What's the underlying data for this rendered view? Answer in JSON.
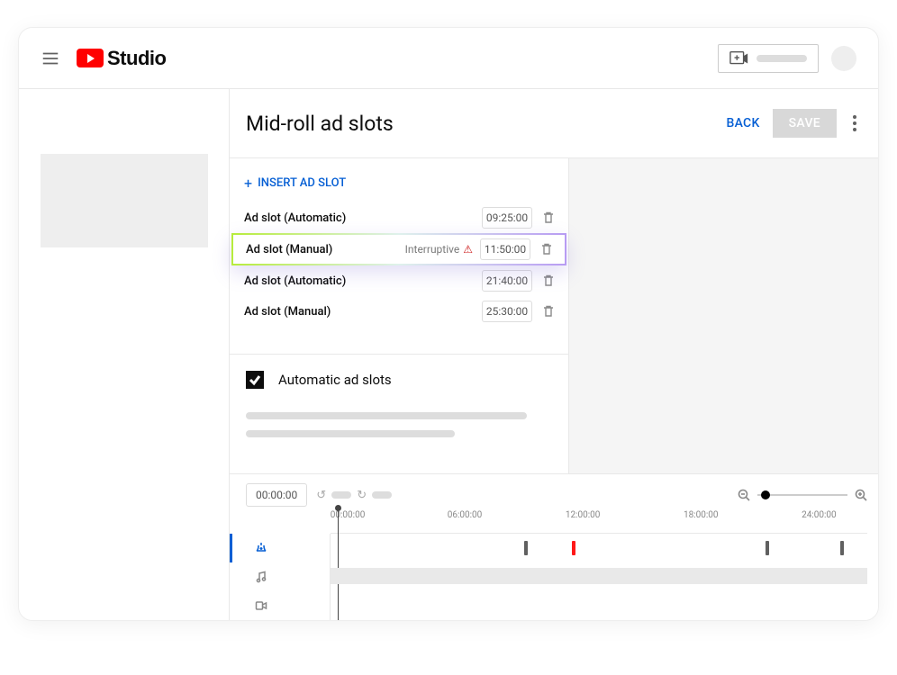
{
  "header": {
    "brand": "Studio"
  },
  "page": {
    "title": "Mid-roll ad slots",
    "back_label": "BACK",
    "save_label": "SAVE"
  },
  "insert_ad_label": "INSERT AD SLOT",
  "ad_slots": [
    {
      "label": "Ad slot (Automatic)",
      "note": "",
      "time": "09:25:00",
      "highlight": false
    },
    {
      "label": "Ad slot (Manual)",
      "note": "Interruptive",
      "time": "11:50:00",
      "highlight": true
    },
    {
      "label": "Ad slot (Automatic)",
      "note": "",
      "time": "21:40:00",
      "highlight": false
    },
    {
      "label": "Ad slot (Manual)",
      "note": "",
      "time": "25:30:00",
      "highlight": false
    }
  ],
  "auto_section": {
    "label": "Automatic ad slots",
    "checked": true
  },
  "timeline": {
    "current": "00:00:00",
    "ticks": [
      "00:00:00",
      "06:00:00",
      "12:00:00",
      "18:00:00",
      "24:00:00"
    ]
  }
}
